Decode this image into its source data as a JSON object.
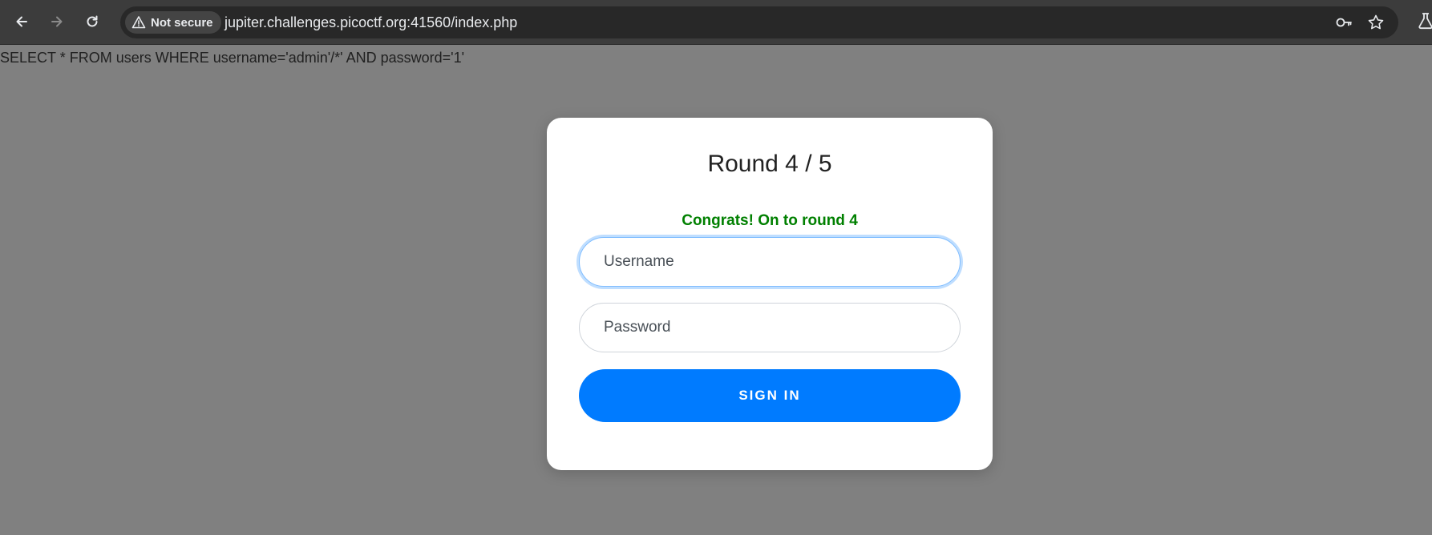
{
  "browser": {
    "security_label": "Not secure",
    "url": "jupiter.challenges.picoctf.org:41560/index.php",
    "icons": [
      "back-icon",
      "forward-icon",
      "reload-icon",
      "warning-icon",
      "key-icon",
      "star-icon",
      "flask-icon"
    ]
  },
  "page": {
    "query_text": "SELECT * FROM users WHERE username='admin'/*' AND password='1'"
  },
  "login": {
    "title": "Round 4 / 5",
    "message": "Congrats! On to round 4",
    "username_placeholder": "Username",
    "username_value": "",
    "password_placeholder": "Password",
    "password_value": "",
    "signin_label": "SIGN IN"
  },
  "colors": {
    "page_bg": "#808080",
    "success_text": "#008000",
    "primary_button": "#007bff",
    "toolbar_bg": "#3c3c3c"
  }
}
